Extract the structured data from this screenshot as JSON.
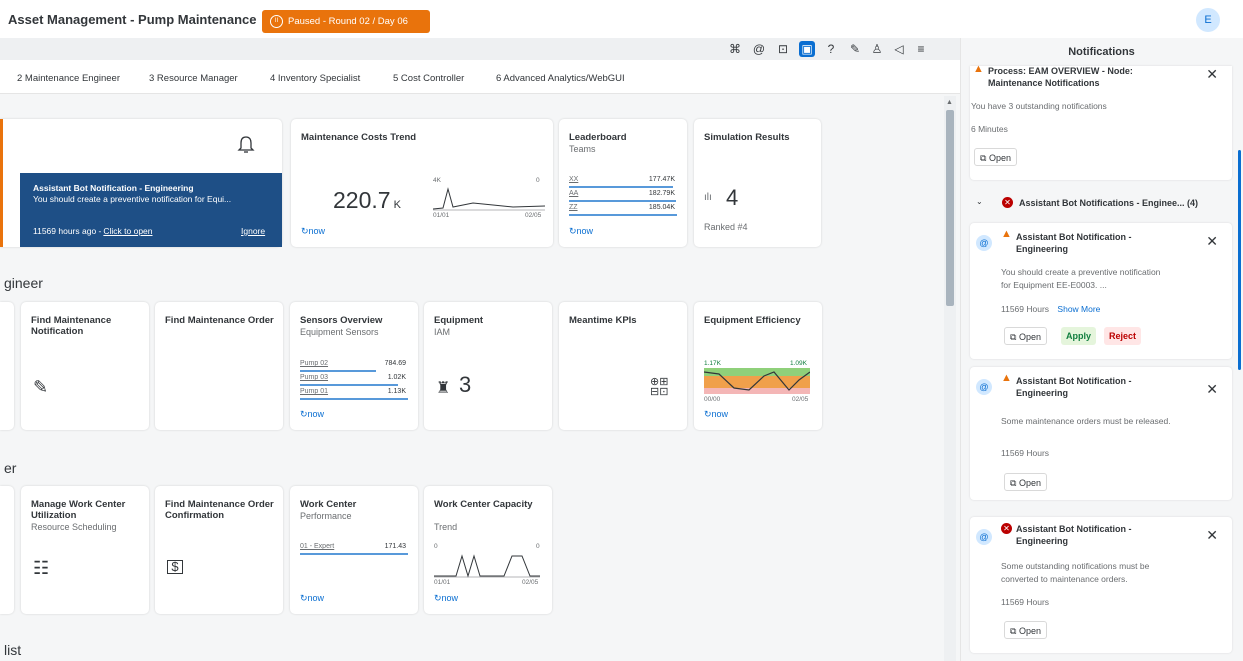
{
  "header": {
    "app_title": "Asset Management - Pump Maintenance",
    "status_button": "Paused - Round 02 / Day 06",
    "avatar_initial": "E"
  },
  "tabs": [
    "2 Maintenance Engineer",
    "3 Resource Manager",
    "4 Inventory Specialist",
    "5 Cost Controller",
    "6 Advanced Analytics/WebGUI"
  ],
  "notification_tile": {
    "title": "Assistant Bot Notification - Engineering",
    "description": "You should create a preventive notification for Equi...",
    "time": "11569 hours ago -",
    "link": "Click to open",
    "ignore": "Ignore"
  },
  "row1": {
    "costs": {
      "title": "Maintenance Costs Trend",
      "value": "220.7",
      "unit": "K",
      "y_top": "4K",
      "y_right": "0",
      "x_start": "01/01",
      "x_end": "02/05",
      "footer": "now"
    },
    "leaderboard": {
      "title": "Leaderboard",
      "subtitle": "Teams",
      "rows": [
        {
          "label": "XX",
          "value": "177.47K"
        },
        {
          "label": "AA",
          "value": "182.79K"
        },
        {
          "label": "ZZ",
          "value": "185.04K"
        }
      ],
      "footer": "now"
    },
    "simulation": {
      "title": "Simulation Results",
      "value": "4",
      "subtitle": "Ranked #4"
    }
  },
  "section_engineer": "gineer",
  "row2": {
    "find_notification": {
      "title": "Find Maintenance Notification"
    },
    "find_order": {
      "title": "Find Maintenance Order"
    },
    "sensors": {
      "title": "Sensors Overview",
      "subtitle": "Equipment Sensors",
      "rows": [
        {
          "label": "Pump 02",
          "value": "784.69"
        },
        {
          "label": "Pump 03",
          "value": "1.02K"
        },
        {
          "label": "Pump 01",
          "value": "1.13K"
        }
      ],
      "footer": "now"
    },
    "equipment": {
      "title": "Equipment",
      "subtitle": "IAM",
      "value": "3"
    },
    "meantime": {
      "title": "Meantime KPIs"
    },
    "efficiency": {
      "title": "Equipment Efficiency",
      "y_left": "1.17K",
      "y_right": "1.09K",
      "x_start": "00/00",
      "x_end": "02/05",
      "footer": "now"
    }
  },
  "section_manager": "er",
  "row3": {
    "manage_wc": {
      "title": "Manage Work Center Utilization",
      "subtitle": "Resource Scheduling"
    },
    "find_confirmation": {
      "title": "Find Maintenance Order Confirmation"
    },
    "wc_performance": {
      "title": "Work Center",
      "subtitle": "Performance",
      "row_label": "01 - Expert",
      "row_value": "171.43",
      "footer": "now"
    },
    "wc_capacity": {
      "title": "Work Center Capacity",
      "subtitle": "Trend",
      "y_left": "0",
      "y_right": "0",
      "x_start": "01/01",
      "x_end": "02/05",
      "footer": "now"
    }
  },
  "section_list": "list",
  "panel": {
    "title": "Notifications",
    "process_card": {
      "title": "Process: EAM OVERVIEW - Node: Maintenance Notifications",
      "body": "You have 3 outstanding notifications",
      "time": "6 Minutes",
      "open": "Open"
    },
    "group": {
      "title": "Assistant Bot Notifications - Enginee... (4)"
    },
    "items": [
      {
        "title": "Assistant Bot Notification - Engineering",
        "body": "You should create a preventive notification for Equipment EE-E0003. ...",
        "time": "11569 Hours",
        "show_more": "Show More",
        "open": "Open",
        "apply": "Apply",
        "reject": "Reject"
      },
      {
        "title": "Assistant Bot Notification - Engineering",
        "body": "Some maintenance orders must be released.",
        "time": "11569 Hours",
        "open": "Open"
      },
      {
        "title": "Assistant Bot Notification - Engineering",
        "body": "Some outstanding notifications must be converted to maintenance orders.",
        "time": "11569 Hours",
        "open": "Open"
      }
    ]
  },
  "colors": {
    "accent": "#0a6ed1",
    "warning": "#e9730c",
    "error": "#bb0000",
    "banner": "#1e4f86"
  }
}
